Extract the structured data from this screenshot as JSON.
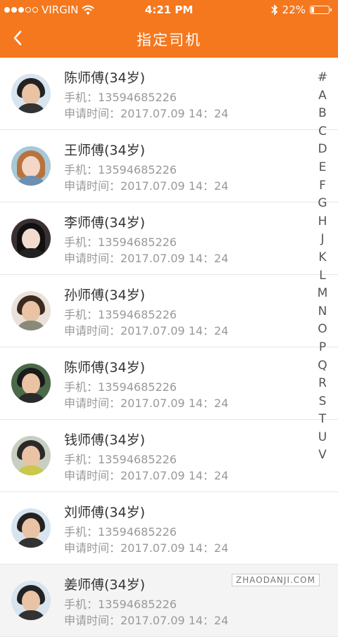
{
  "status_bar": {
    "carrier": "VIRGIN",
    "time": "4:21 PM",
    "battery": "22%",
    "battery_level": 0.22,
    "signal_dots_filled": 3,
    "signal_dots_total": 5,
    "icons": [
      "wifi-icon",
      "bluetooth-icon",
      "battery-icon"
    ]
  },
  "nav": {
    "title": "指定司机",
    "back_icon": "chevron-left-icon"
  },
  "drivers": [
    {
      "name": "陈师傅(34岁)",
      "phone": "手机：13594685226",
      "time": "申请时间：2017.07.09  14：24"
    },
    {
      "name": "王师傅(34岁)",
      "phone": "手机：13594685226",
      "time": "申请时间：2017.07.09  14：24"
    },
    {
      "name": "李师傅(34岁)",
      "phone": "手机：13594685226",
      "time": "申请时间：2017.07.09  14：24"
    },
    {
      "name": "孙师傅(34岁)",
      "phone": "手机：13594685226",
      "time": "申请时间：2017.07.09  14：24"
    },
    {
      "name": "陈师傅(34岁)",
      "phone": "手机：13594685226",
      "time": "申请时间：2017.07.09  14：24"
    },
    {
      "name": "钱师傅(34岁)",
      "phone": "手机：13594685226",
      "time": "申请时间：2017.07.09  14：24"
    },
    {
      "name": "刘师傅(34岁)",
      "phone": "手机：13594685226",
      "time": "申请时间：2017.07.09  14：24"
    },
    {
      "name": "姜师傅(34岁)",
      "phone": "手机：13594685226",
      "time": "申请时间：2017.07.09  14：24"
    }
  ],
  "index_letters": [
    "#",
    "A",
    "B",
    "C",
    "D",
    "E",
    "F",
    "G",
    "H",
    "J",
    "K",
    "L",
    "M",
    "N",
    "O",
    "P",
    "Q",
    "R",
    "S",
    "T",
    "U",
    "V"
  ],
  "watermark": "ZHAODANJI.COM",
  "colors": {
    "accent": "#f5781e",
    "name_text": "#333333",
    "secondary_text": "#999999"
  }
}
